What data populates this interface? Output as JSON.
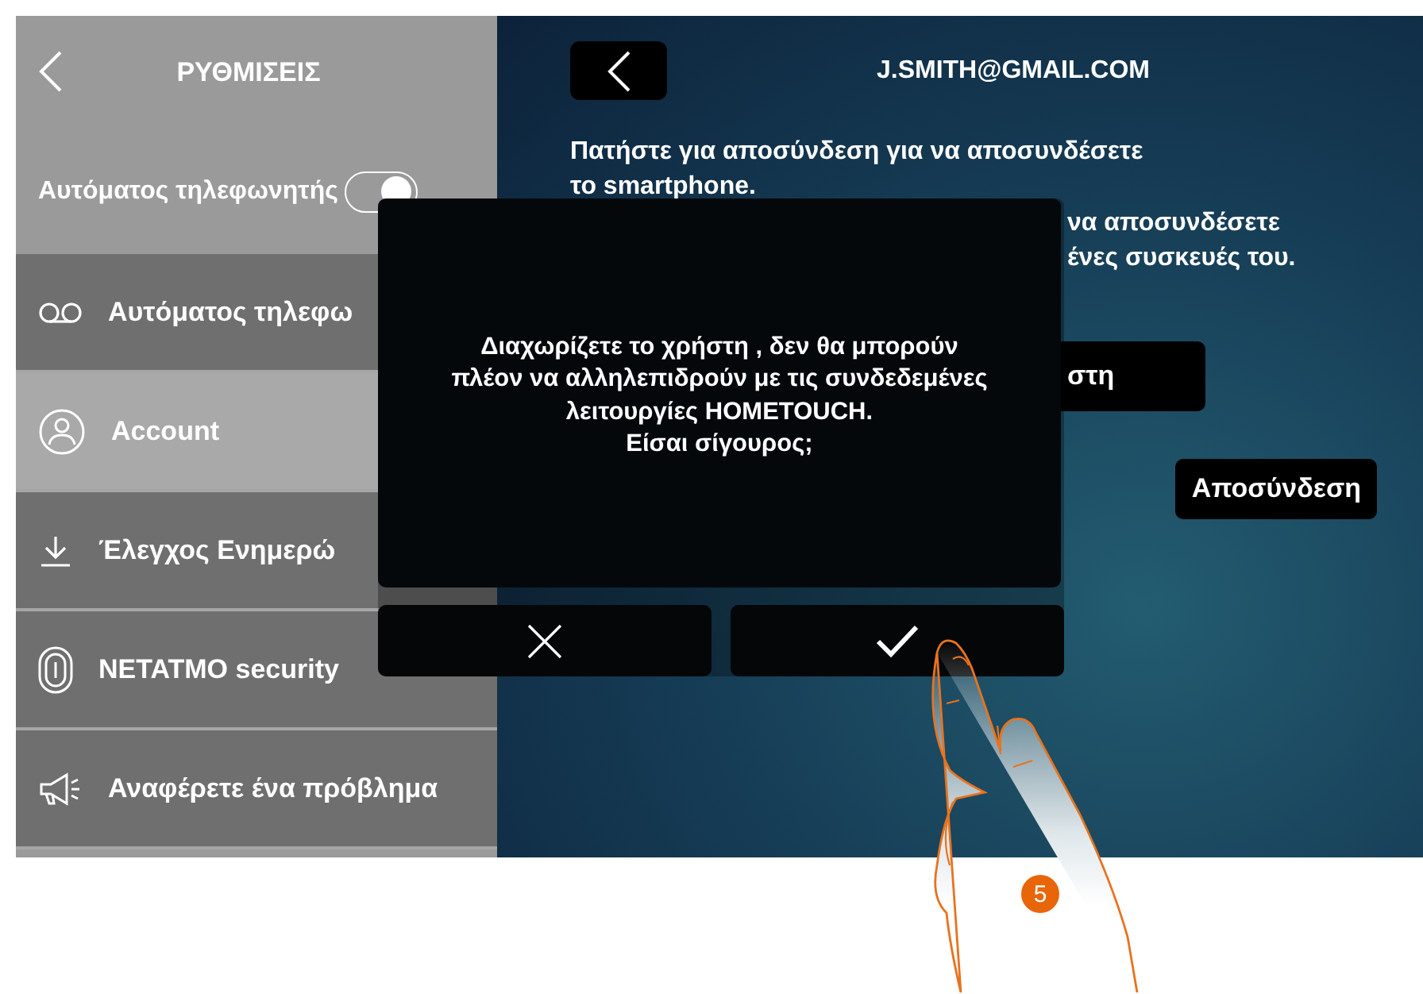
{
  "sidebar": {
    "title": "ΡΥΘΜΙΣΕΙΣ",
    "toggle_row": {
      "label": "Αυτόματος τηλεφωνητής",
      "on": true
    },
    "items": [
      {
        "kind": "voicemail",
        "label": "Αυτόματος τηλεφω",
        "selected": false
      },
      {
        "kind": "account",
        "label": "Account",
        "selected": true
      },
      {
        "kind": "download",
        "label": "Έλεγχος Ενημερώ",
        "selected": false
      },
      {
        "kind": "fingerprint",
        "label": "NETATMO security",
        "selected": false
      },
      {
        "kind": "megaphone",
        "label": "Αναφέρετε ένα πρόβλημα",
        "selected": false
      }
    ]
  },
  "main": {
    "title": "J.SMITH@GMAIL.COM",
    "paragraphs": [
      "Πατήστε για αποσύνδεση για να αποσυνδέσετε\nτο smartphone.",
      "να αποσυνδέσετε\nένες συσκευές του."
    ],
    "disconnect_user_button": "στη",
    "devices": [
      {
        "button": "Αποσύνδεση"
      }
    ]
  },
  "dialog": {
    "message": "Διαχωρίζετε το χρήστη , δεν θα μπορούν\nπλέον να αλληλεπιδρούν με τις συνδεδεμένες\nλειτουργίες HOMETOUCH.\nΕίσαι σίγουρος;",
    "buttons": [
      {
        "kind": "cancel"
      },
      {
        "kind": "confirm"
      }
    ]
  },
  "step_badge": "5"
}
